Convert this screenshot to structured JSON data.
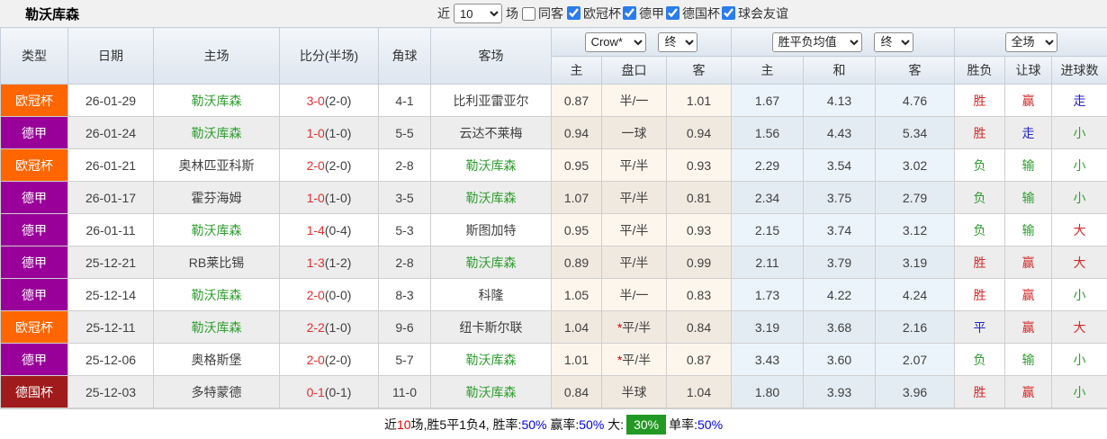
{
  "header": {
    "title": "勒沃库森",
    "recent_label": "近",
    "recent_value": "10",
    "games_label": "场",
    "same_venue_label": "同客",
    "league_filters": [
      {
        "label": "欧冠杯",
        "checked": true
      },
      {
        "label": "德甲",
        "checked": true
      },
      {
        "label": "德国杯",
        "checked": true
      },
      {
        "label": "球会友谊",
        "checked": true
      }
    ]
  },
  "table": {
    "columns": {
      "type": "类型",
      "date": "日期",
      "home": "主场",
      "score": "比分(半场)",
      "corner": "角球",
      "away": "客场"
    },
    "selects": {
      "odds_company": "Crow*",
      "odds_time": "终",
      "avg_label": "胜平负均值",
      "avg_time": "终",
      "scope": "全场"
    },
    "subheaders": {
      "odds_home": "主",
      "handicap": "盘口",
      "odds_away": "客",
      "avg_home": "主",
      "avg_draw": "和",
      "avg_away": "客",
      "result": "胜负",
      "handicap_result": "让球",
      "goals": "进球数"
    },
    "league_colors": {
      "欧冠杯": "#ff6600",
      "德甲": "#990099",
      "德国杯": "#a01b1b"
    },
    "result_colors": {
      "胜": "#d42a2a",
      "负": "#2f9e2f",
      "平": "#2525cc",
      "赢": "#d42a2a",
      "输": "#2f9e2f",
      "走": "#2525cc",
      "大": "#d42a2a",
      "小": "#2f9e2f"
    },
    "rows": [
      {
        "league": "欧冠杯",
        "date": "26-01-29",
        "home": "勒沃库森",
        "score": "3-0",
        "half": "(2-0)",
        "corner": "4-1",
        "away": "比利亚雷亚尔",
        "odds_home": "0.87",
        "handicap": "半/一",
        "odds_away": "1.01",
        "avg_home": "1.67",
        "avg_draw": "4.13",
        "avg_away": "4.76",
        "result": "胜",
        "handicap_result": "赢",
        "goals": "走"
      },
      {
        "league": "德甲",
        "date": "26-01-24",
        "home": "勒沃库森",
        "score": "1-0",
        "half": "(1-0)",
        "corner": "5-5",
        "away": "云达不莱梅",
        "odds_home": "0.94",
        "handicap": "一球",
        "odds_away": "0.94",
        "avg_home": "1.56",
        "avg_draw": "4.43",
        "avg_away": "5.34",
        "result": "胜",
        "handicap_result": "走",
        "goals": "小"
      },
      {
        "league": "欧冠杯",
        "date": "26-01-21",
        "home": "奥林匹亚科斯",
        "score": "2-0",
        "half": "(2-0)",
        "corner": "2-8",
        "away": "勒沃库森",
        "odds_home": "0.95",
        "handicap": "平/半",
        "odds_away": "0.93",
        "avg_home": "2.29",
        "avg_draw": "3.54",
        "avg_away": "3.02",
        "result": "负",
        "handicap_result": "输",
        "goals": "小"
      },
      {
        "league": "德甲",
        "date": "26-01-17",
        "home": "霍芬海姆",
        "score": "1-0",
        "half": "(1-0)",
        "corner": "3-5",
        "away": "勒沃库森",
        "odds_home": "1.07",
        "handicap": "平/半",
        "odds_away": "0.81",
        "avg_home": "2.34",
        "avg_draw": "3.75",
        "avg_away": "2.79",
        "result": "负",
        "handicap_result": "输",
        "goals": "小"
      },
      {
        "league": "德甲",
        "date": "26-01-11",
        "home": "勒沃库森",
        "score": "1-4",
        "half": "(0-4)",
        "corner": "5-3",
        "away": "斯图加特",
        "odds_home": "0.95",
        "handicap": "平/半",
        "odds_away": "0.93",
        "avg_home": "2.15",
        "avg_draw": "3.74",
        "avg_away": "3.12",
        "result": "负",
        "handicap_result": "输",
        "goals": "大"
      },
      {
        "league": "德甲",
        "date": "25-12-21",
        "home": "RB莱比锡",
        "score": "1-3",
        "half": "(1-2)",
        "corner": "2-8",
        "away": "勒沃库森",
        "odds_home": "0.89",
        "handicap": "平/半",
        "odds_away": "0.99",
        "avg_home": "2.11",
        "avg_draw": "3.79",
        "avg_away": "3.19",
        "result": "胜",
        "handicap_result": "赢",
        "goals": "大"
      },
      {
        "league": "德甲",
        "date": "25-12-14",
        "home": "勒沃库森",
        "score": "2-0",
        "half": "(0-0)",
        "corner": "8-3",
        "away": "科隆",
        "odds_home": "1.05",
        "handicap": "半/一",
        "odds_away": "0.83",
        "avg_home": "1.73",
        "avg_draw": "4.22",
        "avg_away": "4.24",
        "result": "胜",
        "handicap_result": "赢",
        "goals": "小"
      },
      {
        "league": "欧冠杯",
        "date": "25-12-11",
        "home": "勒沃库森",
        "score": "2-2",
        "half": "(1-0)",
        "corner": "9-6",
        "away": "纽卡斯尔联",
        "odds_home": "1.04",
        "handicap": "*平/半",
        "odds_away": "0.84",
        "avg_home": "3.19",
        "avg_draw": "3.68",
        "avg_away": "2.16",
        "result": "平",
        "handicap_result": "赢",
        "goals": "大"
      },
      {
        "league": "德甲",
        "date": "25-12-06",
        "home": "奥格斯堡",
        "score": "2-0",
        "half": "(2-0)",
        "corner": "5-7",
        "away": "勒沃库森",
        "odds_home": "1.01",
        "handicap": "*平/半",
        "odds_away": "0.87",
        "avg_home": "3.43",
        "avg_draw": "3.60",
        "avg_away": "2.07",
        "result": "负",
        "handicap_result": "输",
        "goals": "小"
      },
      {
        "league": "德国杯",
        "date": "25-12-03",
        "home": "多特蒙德",
        "score": "0-1",
        "half": "(0-1)",
        "corner": "11-0",
        "away": "勒沃库森",
        "odds_home": "0.84",
        "handicap": "半球",
        "odds_away": "1.04",
        "avg_home": "1.80",
        "avg_draw": "3.93",
        "avg_away": "3.96",
        "result": "胜",
        "handicap_result": "赢",
        "goals": "小"
      }
    ]
  },
  "summary": {
    "segments": [
      {
        "text": "近",
        "style": "plain"
      },
      {
        "text": "10",
        "style": "red"
      },
      {
        "text": "场,胜5平1负4, 胜率:",
        "style": "plain"
      },
      {
        "text": "50%",
        "style": "blue"
      },
      {
        "text": " 赢率:",
        "style": "plain"
      },
      {
        "text": "50%",
        "style": "blue"
      },
      {
        "text": " 大:",
        "style": "plain"
      },
      {
        "text": "30%",
        "style": "badge"
      },
      {
        "text": "单率:",
        "style": "plain"
      },
      {
        "text": "50%",
        "style": "blue"
      }
    ]
  }
}
